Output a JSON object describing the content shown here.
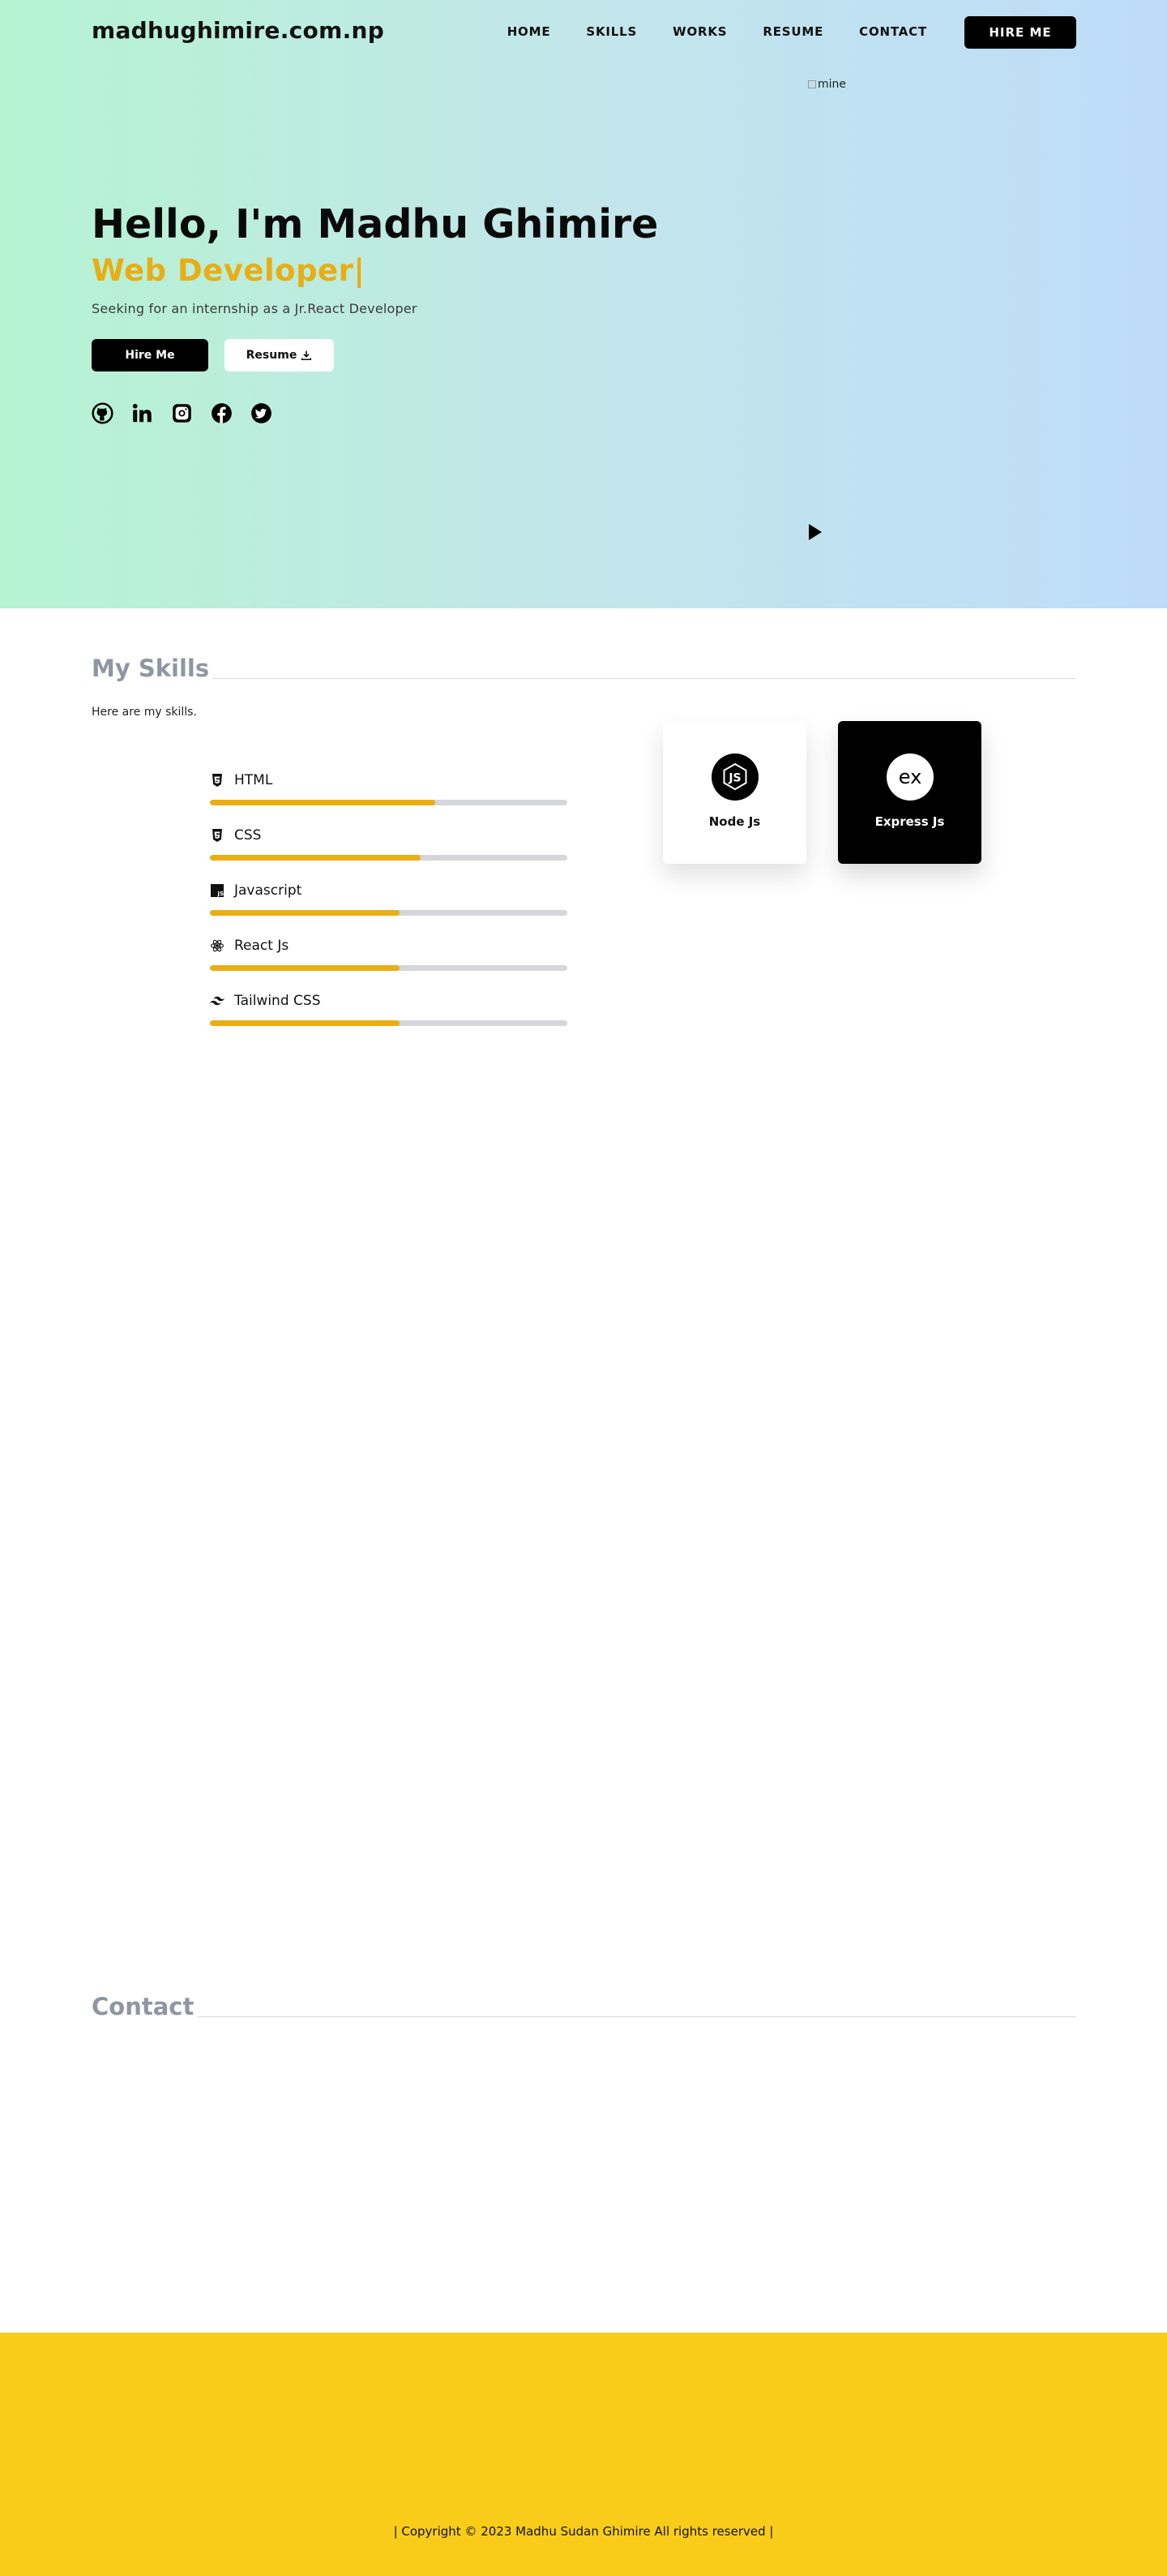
{
  "nav": {
    "brand": "madhughimire.com.np",
    "links": [
      "HOME",
      "SKILLS",
      "WORKS",
      "RESUME",
      "CONTACT"
    ],
    "hire_label": "HIRE ME"
  },
  "hero": {
    "image_alt": "mine",
    "title": "Hello, I'm Madhu Ghimire",
    "role": "Web Developer|",
    "subtitle": "Seeking for an internship as a Jr.React Developer",
    "hire_button": "Hire Me",
    "resume_button": "Resume",
    "socials": [
      "github-icon",
      "linkedin-icon",
      "instagram-icon",
      "facebook-icon",
      "twitter-icon"
    ]
  },
  "skills": {
    "title": "My Skills",
    "intro": "Here are my skills.",
    "bars": [
      {
        "name": "HTML",
        "icon": "html5-icon",
        "level": 0.63
      },
      {
        "name": "CSS",
        "icon": "css3-icon",
        "level": 0.59
      },
      {
        "name": "Javascript",
        "icon": "javascript-icon",
        "level": 0.53
      },
      {
        "name": "React Js",
        "icon": "react-icon",
        "level": 0.53
      },
      {
        "name": "Tailwind CSS",
        "icon": "tailwind-icon",
        "level": 0.53
      }
    ],
    "cards": [
      {
        "name": "Node Js",
        "icon": "nodejs-icon"
      },
      {
        "name": "Express Js",
        "icon": "express-icon"
      }
    ]
  },
  "contact": {
    "title": "Contact"
  },
  "footer": {
    "text": "| Copyright © 2023 Madhu Sudan Ghimire All rights reserved |"
  },
  "colors": {
    "accent": "#e9ae13",
    "footer_bg": "#f8cc18",
    "hero_gradient_start": "#b6f3d2",
    "hero_gradient_end": "#bedcfa"
  }
}
